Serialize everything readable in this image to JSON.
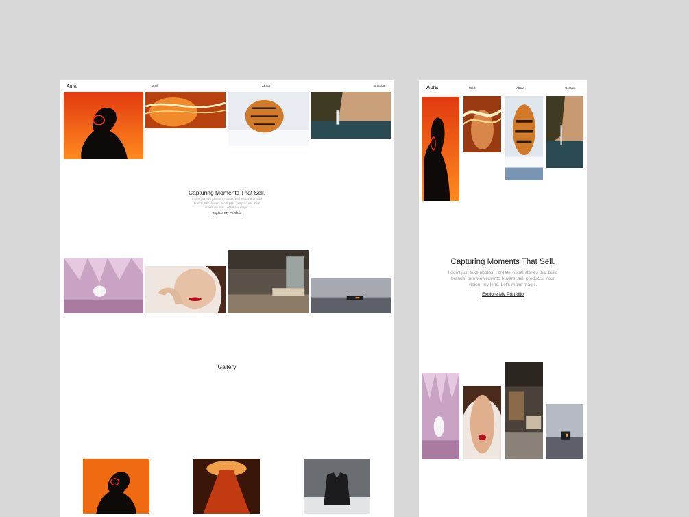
{
  "desktop": {
    "nav": {
      "logo": "Aura",
      "links": [
        "Work",
        "About",
        "Contact"
      ]
    },
    "hero": {
      "title": "Capturing Moments That Sell.",
      "text_lines": [
        "I don't just take photos, I create visual stories that build",
        "brands, turn viewers into buyers ,sell products. Your",
        "vision, my lens. Let's make magic."
      ],
      "cta": "Explore My Portfolio"
    },
    "gallery": {
      "title": "Gallery"
    }
  },
  "mobile": {
    "nav": {
      "logo": "Aura",
      "links": [
        "Work",
        "About",
        "Contact"
      ]
    },
    "hero": {
      "title": "Capturing Moments That Sell.",
      "text_lines": [
        "I don't just take photos, I create visual stories that build",
        "brands, turn viewers into buyers ,sell products. Your",
        "vision, my lens. Let's make magic."
      ],
      "cta": "Explore My Portfolio"
    }
  },
  "colors": {
    "page_bg": "#d8d8d8",
    "frame_bg": "#ffffff",
    "text": "#1a1a1a",
    "muted_text": "#9a9a9a"
  }
}
